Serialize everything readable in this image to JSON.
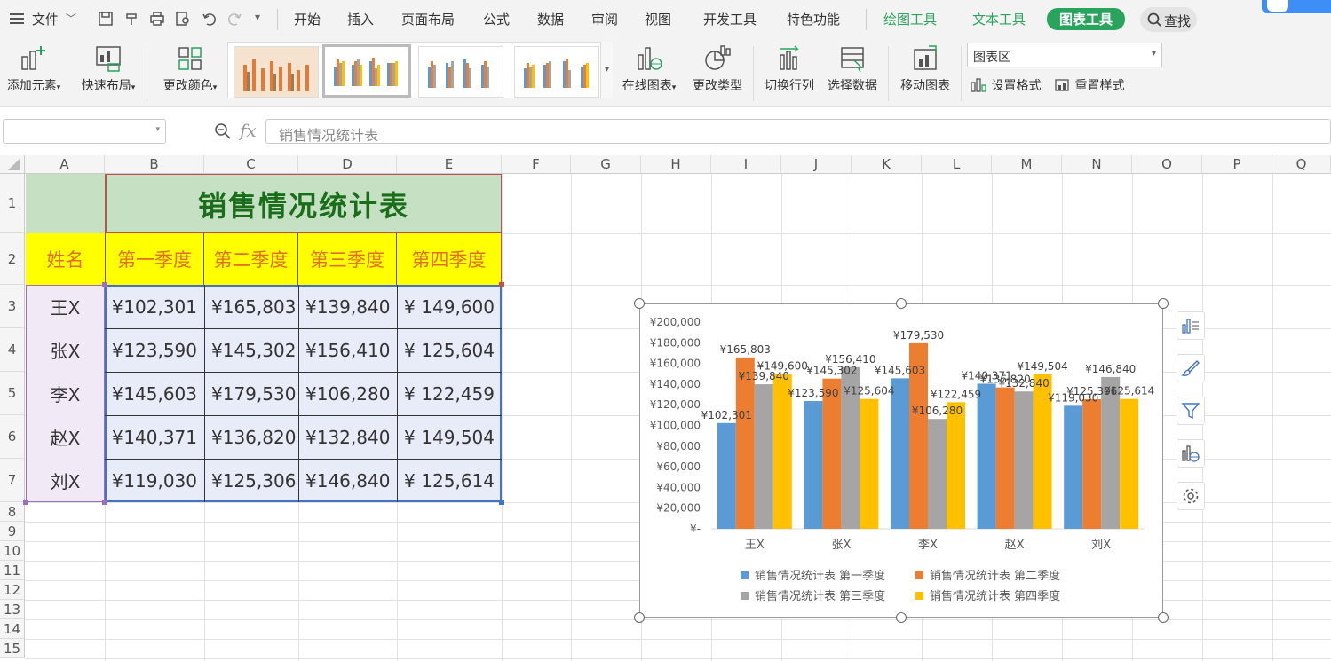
{
  "menubar": {
    "file_label": "文件",
    "items": [
      "开始",
      "插入",
      "页面布局",
      "公式",
      "数据",
      "审阅",
      "视图",
      "开发工具",
      "特色功能"
    ],
    "context_tabs": [
      "绘图工具",
      "文本工具"
    ],
    "active_tab": "图表工具",
    "search_label": "查找"
  },
  "ribbon": {
    "add_element": "添加元素",
    "quick_layout": "快速布局",
    "change_color": "更改颜色",
    "online_chart": "在线图表",
    "change_type": "更改类型",
    "switch_row_col": "切换行列",
    "select_data": "选择数据",
    "move_chart": "移动图表",
    "chart_area_select": "图表区",
    "set_format": "设置格式",
    "reset_style": "重置样式"
  },
  "formula_bar": {
    "name_box": "",
    "fx": "fx",
    "content": "销售情况统计表"
  },
  "sheet": {
    "columns": [
      "A",
      "B",
      "C",
      "D",
      "E",
      "F",
      "G",
      "H",
      "I",
      "J",
      "K",
      "L",
      "M",
      "N",
      "O",
      "P",
      "Q"
    ],
    "rows": [
      "1",
      "2",
      "3",
      "4",
      "5",
      "6",
      "7",
      "8",
      "9",
      "10",
      "11",
      "12",
      "13",
      "14",
      "15"
    ],
    "title": "销售情况统计表",
    "headers": [
      "姓名",
      "第一季度",
      "第二季度",
      "第三季度",
      "第四季度"
    ],
    "currency": "¥",
    "data": [
      {
        "name": "王X",
        "values": [
          "102,301",
          "165,803",
          "139,840",
          "149,600"
        ]
      },
      {
        "name": "张X",
        "values": [
          "123,590",
          "145,302",
          "156,410",
          "125,604"
        ]
      },
      {
        "name": "李X",
        "values": [
          "145,603",
          "179,530",
          "106,280",
          "122,459"
        ]
      },
      {
        "name": "赵X",
        "values": [
          "140,371",
          "136,820",
          "132,840",
          "149,504"
        ]
      },
      {
        "name": "刘X",
        "values": [
          "119,030",
          "125,306",
          "146,840",
          "125,614"
        ]
      }
    ]
  },
  "chart_data": {
    "type": "bar",
    "categories": [
      "王X",
      "张X",
      "李X",
      "赵X",
      "刘X"
    ],
    "series": [
      {
        "name": "销售情况统计表 第一季度",
        "color": "#5b9bd5",
        "values": [
          102301,
          123590,
          145603,
          140371,
          119030
        ]
      },
      {
        "name": "销售情况统计表 第二季度",
        "color": "#ed7d31",
        "values": [
          165803,
          145302,
          179530,
          136820,
          125306
        ]
      },
      {
        "name": "销售情况统计表 第三季度",
        "color": "#a5a5a5",
        "values": [
          139840,
          156410,
          106280,
          132840,
          146840
        ]
      },
      {
        "name": "销售情况统计表 第四季度",
        "color": "#ffc000",
        "values": [
          149600,
          125604,
          122459,
          149504,
          125614
        ]
      }
    ],
    "ylim": [
      0,
      200000
    ],
    "yticks": [
      "¥-",
      "¥20,000",
      "¥40,000",
      "¥60,000",
      "¥80,000",
      "¥100,000",
      "¥120,000",
      "¥140,000",
      "¥160,000",
      "¥180,000",
      "¥200,000"
    ],
    "data_labels": [
      [
        "¥102,301",
        "¥123,590",
        "¥145,603",
        "¥140,371",
        "¥119,030"
      ],
      [
        "¥165,803",
        "¥145,302",
        "¥179,530",
        "¥136,820",
        "¥125,306"
      ],
      [
        "¥139,840",
        "¥156,410",
        "¥106,280",
        "¥132,840",
        "¥146,840"
      ],
      [
        "¥149,600",
        "¥125,604",
        "¥122,459",
        "¥149,504",
        "¥125,614"
      ]
    ],
    "legend_position": "bottom",
    "grid": false
  },
  "side_tools": [
    "chart-elements-icon",
    "chart-style-icon",
    "chart-filter-icon",
    "online-chart-icon",
    "chart-settings-icon"
  ]
}
